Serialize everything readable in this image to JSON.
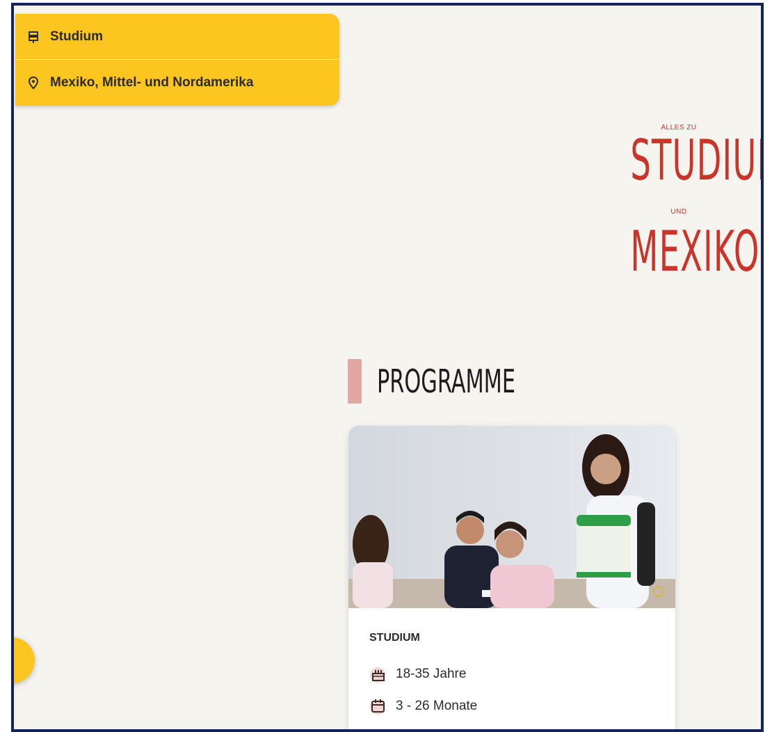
{
  "filters": [
    {
      "label": "Studium",
      "icon": "signpost-icon"
    },
    {
      "label": "Mexiko, Mittel- und Nordamerika",
      "icon": "location-pin-icon"
    }
  ],
  "hero": {
    "pre": "ALLES ZU",
    "topic": "STUDIUM",
    "connector": "UND",
    "country": "MEXIKO"
  },
  "section": {
    "title": "PROGRAMME"
  },
  "card": {
    "type": "STUDIUM",
    "age": "18-35 Jahre",
    "duration": "3 - 26 Monate"
  },
  "colors": {
    "accent_yellow": "#fcc520",
    "hero_red": "#c9342b",
    "section_bar": "#e1a8a1",
    "frame_border": "#14245a"
  }
}
